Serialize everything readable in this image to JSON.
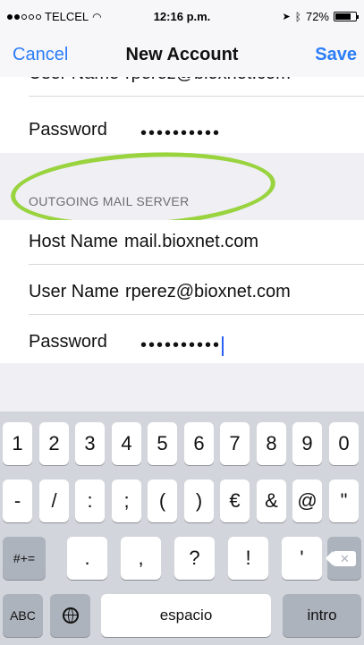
{
  "status_bar": {
    "carrier": "TELCEL",
    "time": "12:16 p.m.",
    "battery": "72%",
    "icons": [
      "signal-dots-icon",
      "wifi-icon",
      "location-icon",
      "bluetooth-icon",
      "battery-icon"
    ]
  },
  "nav": {
    "cancel": "Cancel",
    "title": "New Account",
    "save": "Save"
  },
  "incoming": {
    "user_name_label": "User Name",
    "user_name_value": "rperez@bioxnet.com",
    "password_label": "Password",
    "password_value": "••••••••••"
  },
  "outgoing": {
    "section_header": "OUTGOING MAIL SERVER",
    "host_name_label": "Host Name",
    "host_name_value": "mail.bioxnet.com",
    "user_name_label": "User Name",
    "user_name_value": "rperez@bioxnet.com",
    "password_label": "Password",
    "password_value": "••••••••••"
  },
  "keyboard": {
    "row1": [
      "1",
      "2",
      "3",
      "4",
      "5",
      "6",
      "7",
      "8",
      "9",
      "0"
    ],
    "row2": [
      "-",
      "/",
      ":",
      ";",
      "(",
      ")",
      "€",
      "&",
      "@",
      "\""
    ],
    "row3_left": "#+=",
    "row3": [
      ".",
      ",",
      "?",
      "!",
      "'"
    ],
    "abc": "ABC",
    "space": "espacio",
    "return": "intro"
  },
  "colors": {
    "accent": "#2b7df7",
    "highlight_circle": "#8fcf2a"
  }
}
